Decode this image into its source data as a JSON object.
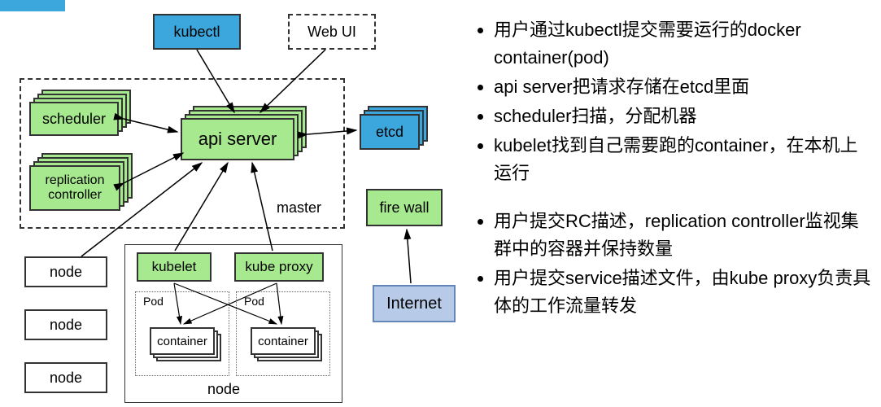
{
  "boxes": {
    "kubectl": "kubectl",
    "webui": "Web UI",
    "scheduler": "scheduler",
    "replication": "replication\ncontroller",
    "apiserver": "api server",
    "etcd": "etcd",
    "master_label": "master",
    "firewall": "fire wall",
    "internet": "Internet",
    "node1": "node",
    "node2": "node",
    "node3": "node",
    "kubelet": "kubelet",
    "kubeproxy": "kube proxy",
    "pod_label_a": "Pod",
    "pod_label_b": "Pod",
    "container_a": "container",
    "container_b": "container",
    "node_detail_label": "node"
  },
  "bullets_group1": [
    "用户通过kubectl提交需要运行的docker container(pod)",
    "api server把请求存储在etcd里面",
    "scheduler扫描，分配机器",
    "kubelet找到自己需要跑的container，在本机上运行"
  ],
  "bullets_group2": [
    "用户提交RC描述，replication controller监视集群中的容器并保持数量",
    "用户提交service描述文件，由kube proxy负责具体的工作流量转发"
  ]
}
